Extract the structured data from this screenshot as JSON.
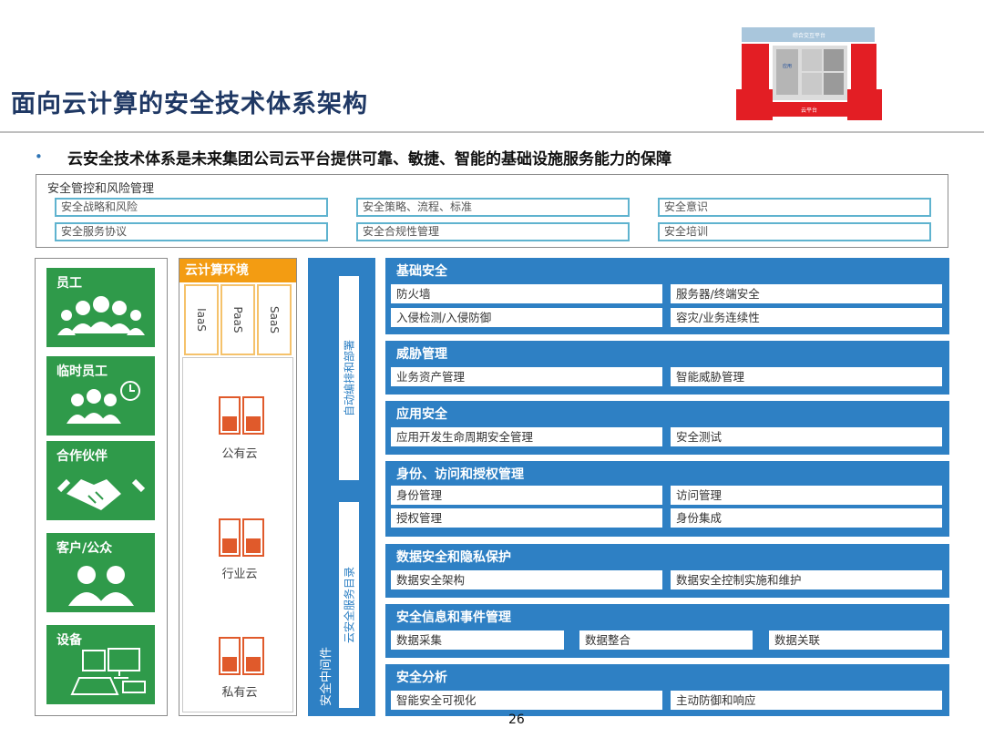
{
  "slide": {
    "title": "面向云计算的安全技术体系架构",
    "subtitle": "云安全技术体系是未来集团公司云平台提供可靠、敏捷、智能的基础设施服务能力的保障",
    "page_number": "26"
  },
  "graphic": {
    "top_label": "综合交互平台",
    "bottom_label": "云平台",
    "left_label": "应用\n系统\n平台"
  },
  "governance": {
    "title": "安全管控和风险管理",
    "items": [
      "安全战略和风险",
      "安全策略、流程、标准",
      "安全意识",
      "安全服务协议",
      "安全合规性管理",
      "安全培训"
    ]
  },
  "users": [
    {
      "label": "员工",
      "icon": "employees-icon"
    },
    {
      "label": "临时员工",
      "icon": "temp-staff-clock-icon"
    },
    {
      "label": "合作伙伴",
      "icon": "handshake-icon"
    },
    {
      "label": "客户/公众",
      "icon": "customers-icon"
    },
    {
      "label": "设备",
      "icon": "devices-icon"
    }
  ],
  "cloud_env": {
    "title": "云计算环境",
    "services": [
      "IaaS",
      "PaaS",
      "SaaS"
    ],
    "clouds": [
      "公有云",
      "行业云",
      "私有云"
    ]
  },
  "middleware": {
    "label": "安全中间件",
    "upper": "自动编排和部署",
    "lower": "云安全服务目录"
  },
  "domains": [
    {
      "title": "基础安全",
      "items": [
        "防火墙",
        "服务器/终端安全",
        "入侵检测/入侵防御",
        "容灾/业务连续性"
      ]
    },
    {
      "title": "威胁管理",
      "items": [
        "业务资产管理",
        "智能威胁管理"
      ]
    },
    {
      "title": "应用安全",
      "items": [
        "应用开发生命周期安全管理",
        "安全测试"
      ]
    },
    {
      "title": "身份、访问和授权管理",
      "items": [
        "身份管理",
        "访问管理",
        "授权管理",
        "身份集成"
      ]
    },
    {
      "title": "数据安全和隐私保护",
      "items": [
        "数据安全架构",
        "数据安全控制实施和维护"
      ]
    },
    {
      "title": "安全信息和事件管理",
      "items": [
        "数据采集",
        "数据整合",
        "数据关联"
      ]
    },
    {
      "title": "安全分析",
      "items": [
        "智能安全可视化",
        "主动防御和响应"
      ]
    }
  ],
  "colors": {
    "title": "#1f3864",
    "domain_blue": "#2e80c4",
    "user_green": "#2f9a4a",
    "cloud_orange": "#f39c12",
    "gov_border": "#5fb3cf",
    "server_red": "#e05a2b"
  }
}
